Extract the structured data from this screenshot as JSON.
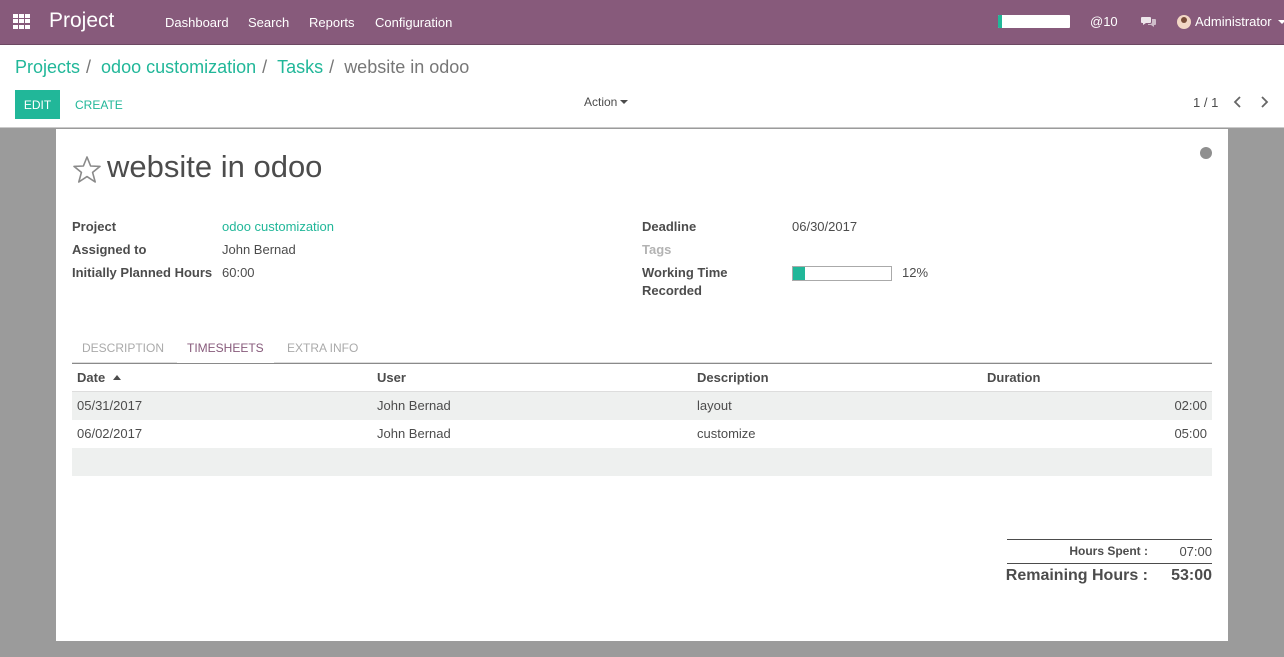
{
  "navbar": {
    "brand": "Project",
    "menu": [
      "Dashboard",
      "Search",
      "Reports",
      "Configuration"
    ],
    "mentions": "@10",
    "user": "Administrator",
    "progress_fraction": 0.06,
    "accent": "#875a7b"
  },
  "breadcrumb": {
    "items": [
      "Projects",
      "odoo customization",
      "Tasks"
    ],
    "separator": "/",
    "current": "website in odoo"
  },
  "toolbar": {
    "edit_label": "EDIT",
    "create_label": "CREATE",
    "action_label": "Action",
    "pager": "1 / 1"
  },
  "task": {
    "title": "website in odoo",
    "starred": false,
    "left_fields": [
      {
        "label": "Project",
        "value": "odoo customization",
        "link": true
      },
      {
        "label": "Assigned to",
        "value": "John Bernad",
        "link": false
      },
      {
        "label": "Initially Planned Hours",
        "value": "60:00",
        "link": false
      }
    ],
    "deadline_label": "Deadline",
    "deadline": "06/30/2017",
    "tags_label": "Tags",
    "working_time_label_1": "Working Time",
    "working_time_label_2": "Recorded",
    "working_time_percent": 12,
    "working_time_text": "12%"
  },
  "tabs": [
    {
      "label": "DESCRIPTION",
      "active": false
    },
    {
      "label": "TIMESHEETS",
      "active": true
    },
    {
      "label": "EXTRA INFO",
      "active": false
    }
  ],
  "timesheets": {
    "columns": [
      "Date",
      "User",
      "Description",
      "Duration"
    ],
    "rows": [
      [
        "05/31/2017",
        "John Bernad",
        "layout",
        "02:00"
      ],
      [
        "06/02/2017",
        "John Bernad",
        "customize",
        "05:00"
      ]
    ]
  },
  "totals": {
    "hours_spent_label": "Hours Spent :",
    "hours_spent": "07:00",
    "remaining_label": "Remaining Hours :",
    "remaining": "53:00"
  },
  "colors": {
    "primary": "#21b799",
    "brand": "#875a7b"
  }
}
